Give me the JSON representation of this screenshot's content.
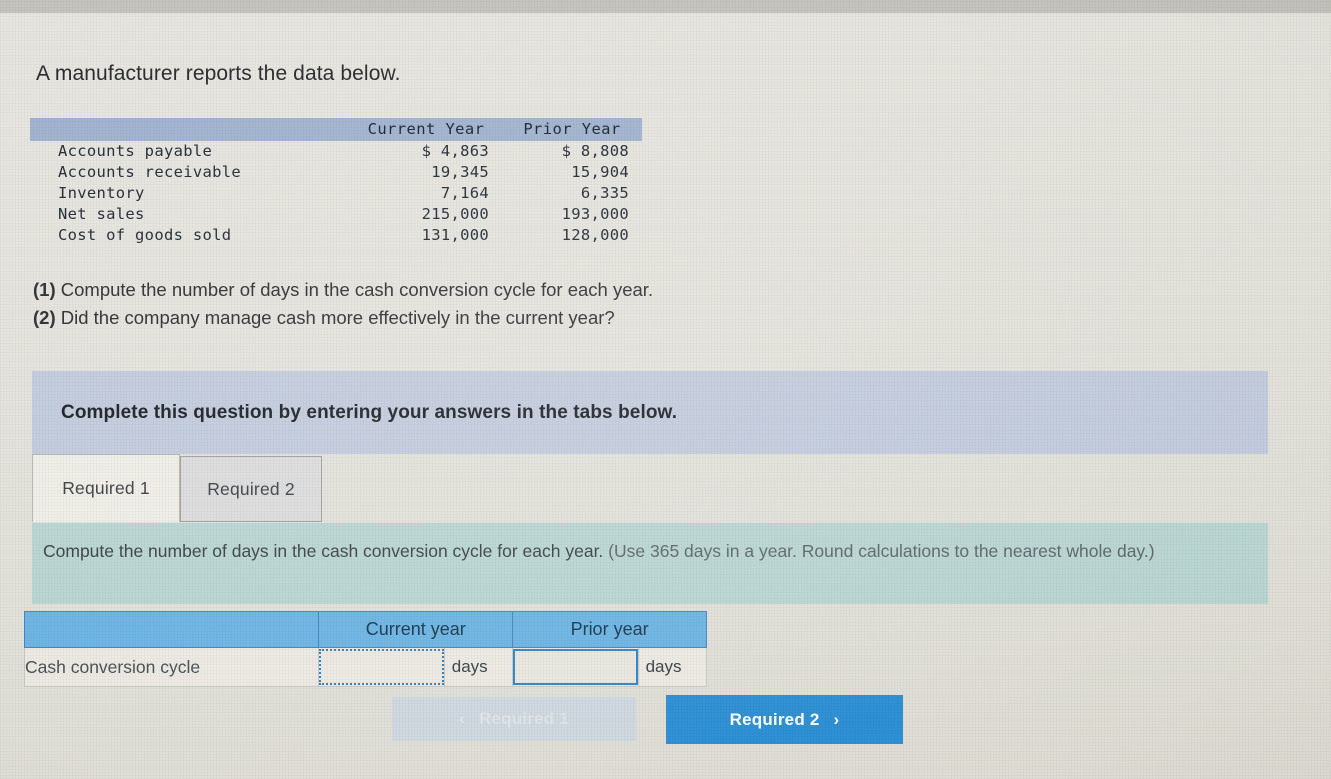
{
  "intro": {
    "text": "A manufacturer reports the data below."
  },
  "data_table": {
    "columns": [
      "",
      "Current Year",
      "Prior Year"
    ],
    "rows": [
      {
        "label": "Accounts payable",
        "current": "$ 4,863",
        "prior": "$ 8,808"
      },
      {
        "label": "Accounts receivable",
        "current": "19,345",
        "prior": "15,904"
      },
      {
        "label": "Inventory",
        "current": "7,164",
        "prior": "6,335"
      },
      {
        "label": "Net sales",
        "current": "215,000",
        "prior": "193,000"
      },
      {
        "label": "Cost of goods sold",
        "current": "131,000",
        "prior": "128,000"
      }
    ]
  },
  "questions": [
    {
      "number": "(1)",
      "text": "Compute the number of days in the cash conversion cycle for each year."
    },
    {
      "number": "(2)",
      "text": "Did the company manage cash more effectively in the current year?"
    }
  ],
  "banner": {
    "text": "Complete this question by entering your answers in the tabs below."
  },
  "tabs": [
    {
      "label": "Required 1",
      "active": true
    },
    {
      "label": "Required 2",
      "active": false
    }
  ],
  "sub_instruction": {
    "main": "Compute the number of days in the cash conversion cycle for each year.",
    "note": "(Use 365 days in a year. Round calculations to the nearest whole day.)"
  },
  "answer_table": {
    "headers": [
      "",
      "Current year",
      "Prior year"
    ],
    "row_label": "Cash conversion cycle",
    "current_value": "",
    "prior_value": "",
    "unit": "days"
  },
  "nav": {
    "prev_label": "Required 1",
    "prev_chevron": "‹",
    "next_label": "Required 2",
    "next_chevron": "›"
  },
  "colors": {
    "page_background": "#e2e1da",
    "banner_background": "#c2cbdd",
    "subinstruction_background": "#b9d5d2",
    "data_header_background": "#9fb2ce",
    "answer_header_background": "#6cb4e4",
    "primary_button": "#2b8fd4",
    "disabled_button": "#cfd8e0",
    "focus_border": "#2f86c8"
  }
}
